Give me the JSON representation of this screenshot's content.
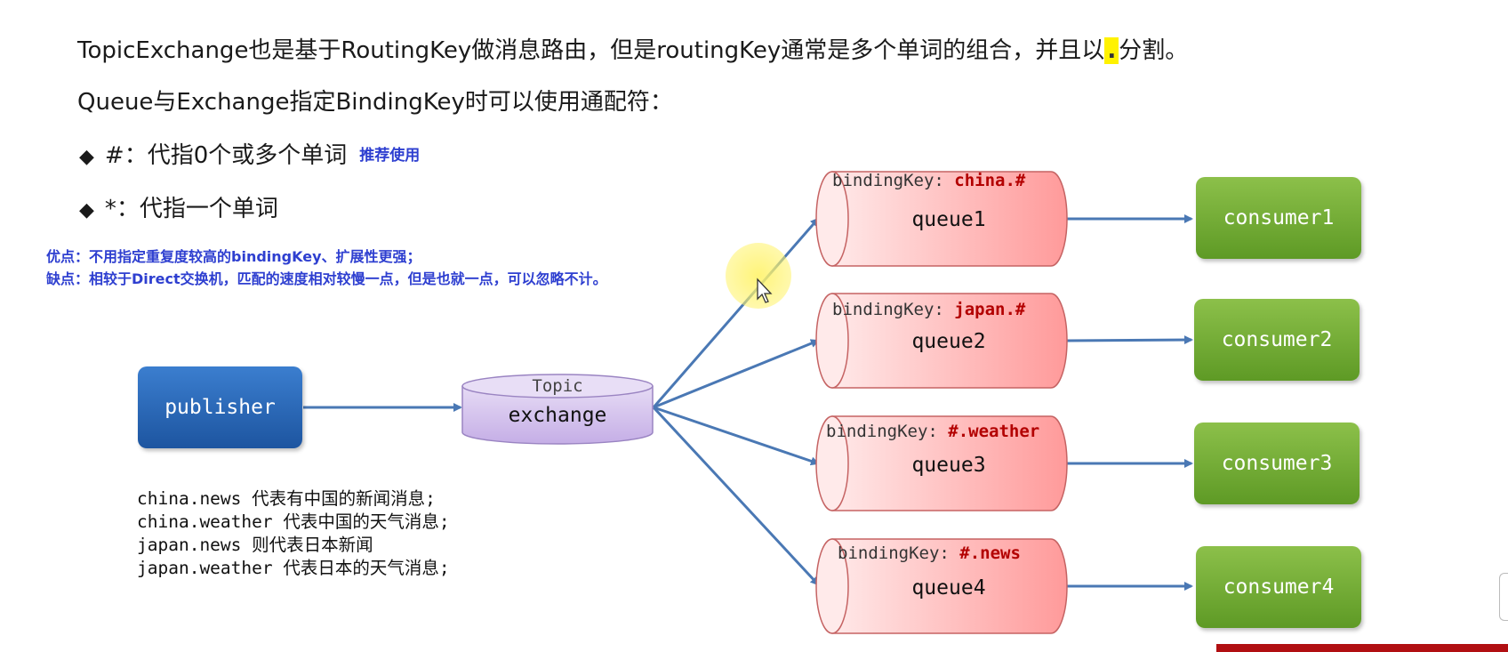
{
  "intro": {
    "line1_before": "TopicExchange也是基于RoutingKey做消息路由，但是routingKey通常是多个单词的组合，并且以",
    "line1_dot": ".",
    "line1_after": "分割。",
    "line2": "Queue与Exchange指定BindingKey时可以使用通配符："
  },
  "wildcards": [
    {
      "text": "#：代指0个或多个单词",
      "tag": "推荐使用"
    },
    {
      "text": "*：代指一个单词"
    }
  ],
  "notes": {
    "pros": "优点：不用指定重复度较高的bindingKey、扩展性更强；",
    "cons": "缺点：相较于Direct交换机，匹配的速度相对较慢一点，但是也就一点，可以忽略不计。"
  },
  "publisher": {
    "label": "publisher"
  },
  "exchange": {
    "type_label": "Topic",
    "label": "exchange"
  },
  "binding_key_prefix": "bindingKey: ",
  "queues": [
    {
      "label": "queue1",
      "binding_key": "china.#"
    },
    {
      "label": "queue2",
      "binding_key": "japan.#"
    },
    {
      "label": "queue3",
      "binding_key": "#.weather"
    },
    {
      "label": "queue4",
      "binding_key": "#.news"
    }
  ],
  "consumers": [
    {
      "label": "consumer1"
    },
    {
      "label": "consumer2"
    },
    {
      "label": "consumer3"
    },
    {
      "label": "consumer4"
    }
  ],
  "examples": [
    "china.news 代表有中国的新闻消息;",
    "china.weather 代表中国的天气消息;",
    "japan.news 则代表日本新闻",
    "japan.weather 代表日本的天气消息;"
  ],
  "colors": {
    "arrow": "#4a78b4",
    "binding_key_value": "#b30000",
    "note_text": "#2e3fd0",
    "queue_fill": "#ff9d9d",
    "exchange_fill": "#cdb6ea",
    "publisher_fill": "#2a67b6",
    "consumer_fill": "#75ad37",
    "highlight": "#fff200"
  }
}
